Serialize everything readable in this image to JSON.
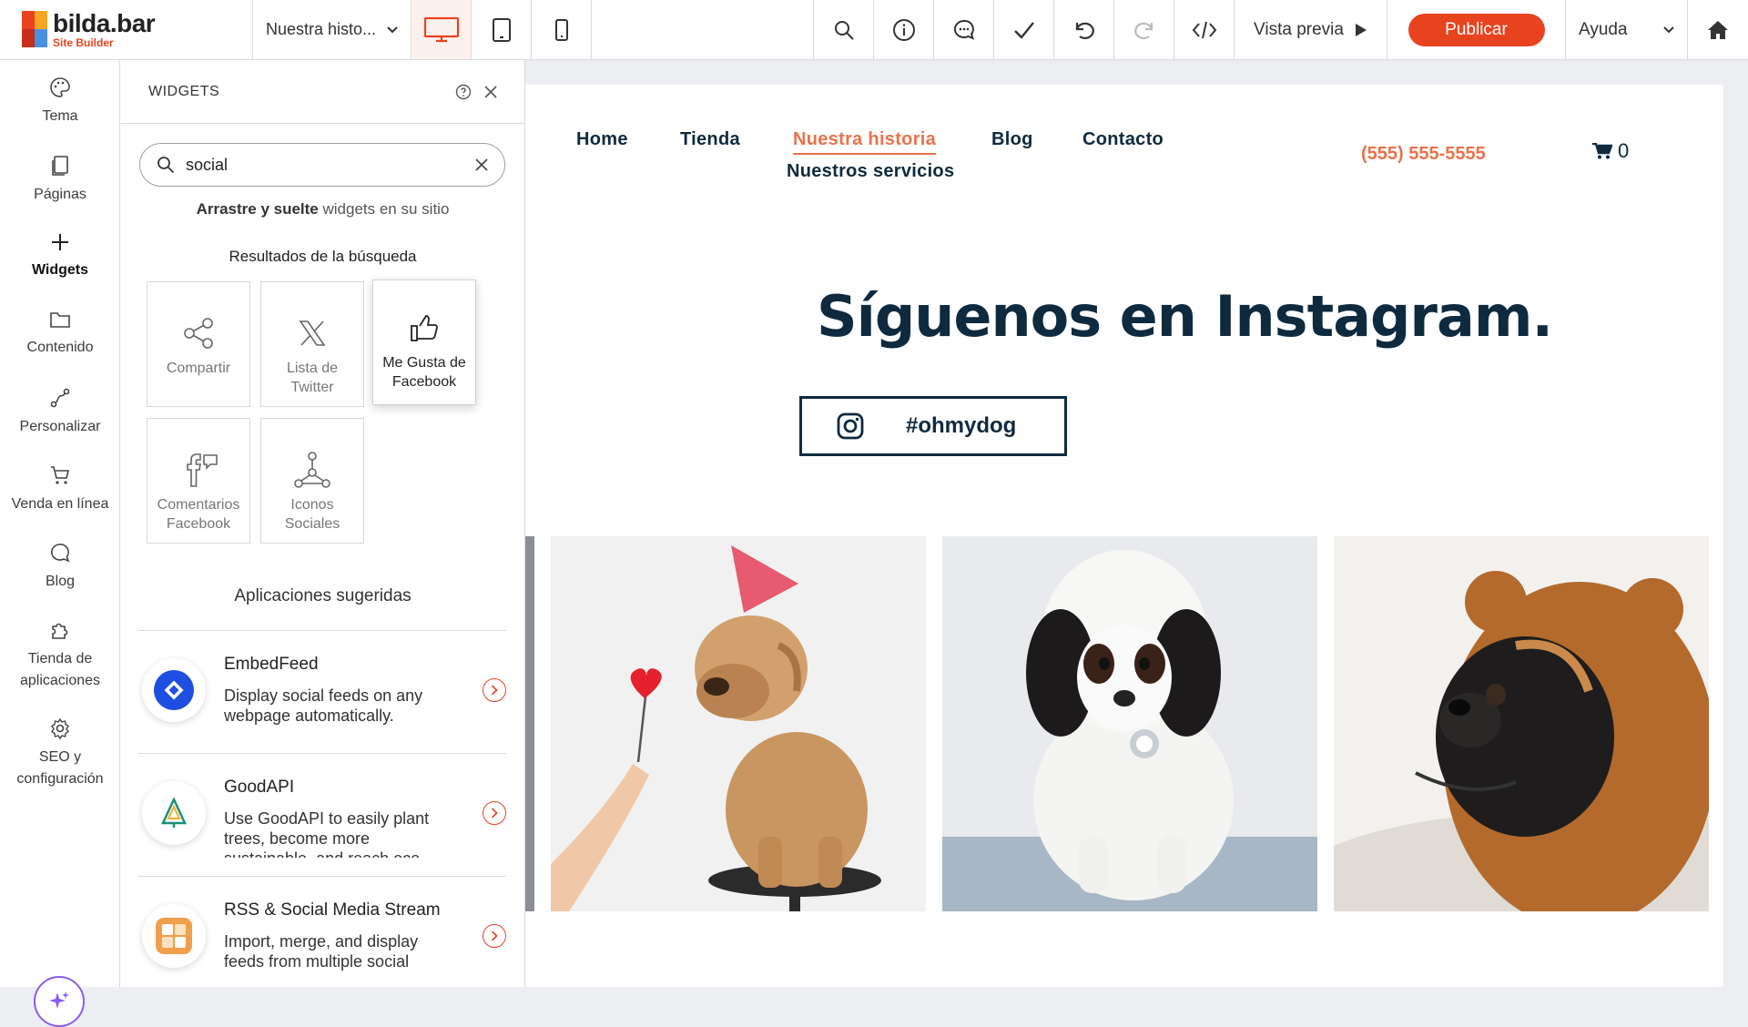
{
  "app": {
    "brand": "bilda.bar",
    "brand_sub": "Site Builder"
  },
  "topbar": {
    "page_selector": "Nuestra histo...",
    "preview_label": "Vista previa",
    "publish_label": "Publicar",
    "help_label": "Ayuda"
  },
  "leftnav": {
    "items": [
      {
        "label": "Tema"
      },
      {
        "label": "Páginas"
      },
      {
        "label": "Widgets"
      },
      {
        "label": "Contenido"
      },
      {
        "label": "Personalizar"
      },
      {
        "label": "Venda en línea"
      },
      {
        "label": "Blog"
      },
      {
        "label": "Tienda de aplicaciones"
      },
      {
        "label": "SEO y configuración"
      }
    ]
  },
  "panel": {
    "title": "WIDGETS",
    "search_value": "social",
    "drag_hint_bold": "Arrastre y suelte",
    "drag_hint_rest": " widgets en su sitio",
    "results_title": "Resultados de la búsqueda",
    "widgets": [
      {
        "label": "Compartir"
      },
      {
        "label": "Lista de Twitter"
      },
      {
        "label": "Me Gusta de Facebook"
      },
      {
        "label": "Comentarios Facebook"
      },
      {
        "label": "Iconos Sociales"
      }
    ],
    "suggested_title": "Aplicaciones sugeridas",
    "apps": [
      {
        "name": "EmbedFeed",
        "desc": "Display social feeds on any webpage automatically."
      },
      {
        "name": "GoodAPI",
        "desc": "Use GoodAPI to easily plant trees, become more sustainable, and reach eco-"
      },
      {
        "name": "RSS & Social Media Stream",
        "desc": "Import, merge, and display feeds from multiple social"
      }
    ]
  },
  "site": {
    "menu": [
      "Home",
      "Tienda",
      "Nuestra historia",
      "Blog",
      "Contacto",
      "Nuestros servicios"
    ],
    "phone": "(555) 555-5555",
    "cart_count": "0",
    "hero_title": "Síguenos en Instagram.",
    "hashtag": "#ohmydog"
  },
  "colors": {
    "accent": "#e8431f",
    "site_accent": "#e8734a",
    "site_navy": "#0f2a3f",
    "ai_purple": "#8b5cf6"
  }
}
